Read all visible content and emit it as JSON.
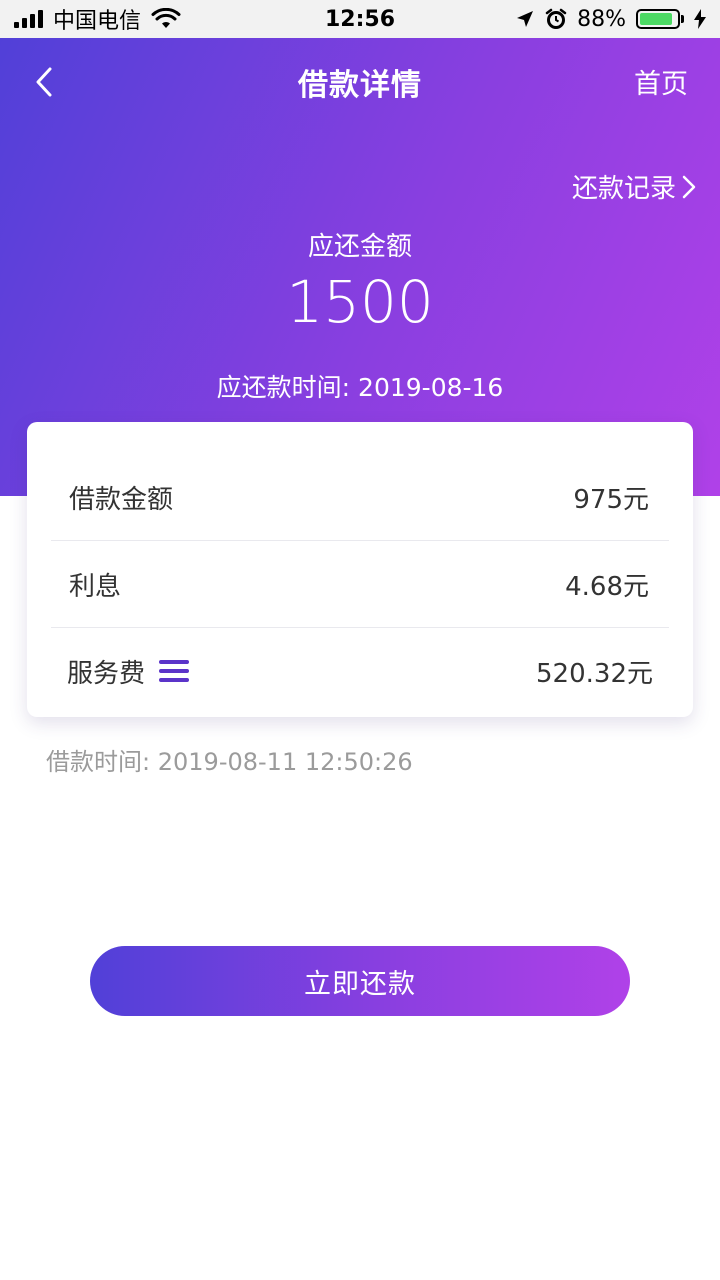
{
  "status_bar": {
    "carrier": "中国电信",
    "time": "12:56",
    "battery_percent": "88%",
    "battery_level": 0.88,
    "icons": [
      "signal-icon",
      "wifi-icon",
      "location-icon",
      "alarm-icon",
      "battery-icon",
      "charging-icon"
    ]
  },
  "nav": {
    "title": "借款详情",
    "home_label": "首页",
    "back_icon": "chevron-left-icon"
  },
  "summary": {
    "records_label": "还款记录",
    "due_label": "应还金额",
    "due_amount": "1500",
    "due_date_label": "应还款时间:",
    "due_date": "2019-08-16"
  },
  "details": {
    "rows": [
      {
        "label": "借款金额",
        "value": "975元"
      },
      {
        "label": "利息",
        "value": "4.68元"
      },
      {
        "label": "服务费",
        "value": "520.32元",
        "icon": "menu-icon"
      }
    ]
  },
  "loan_time": {
    "label": "借款时间:",
    "value": "2019-08-11 12:50:26"
  },
  "actions": {
    "repay_label": "立即还款"
  },
  "colors": {
    "gradient_start": "#5140d8",
    "gradient_mid": "#8a3fe0",
    "gradient_end": "#b041e8",
    "menu_icon": "#5b34c9",
    "muted_text": "#9b9b9b"
  }
}
